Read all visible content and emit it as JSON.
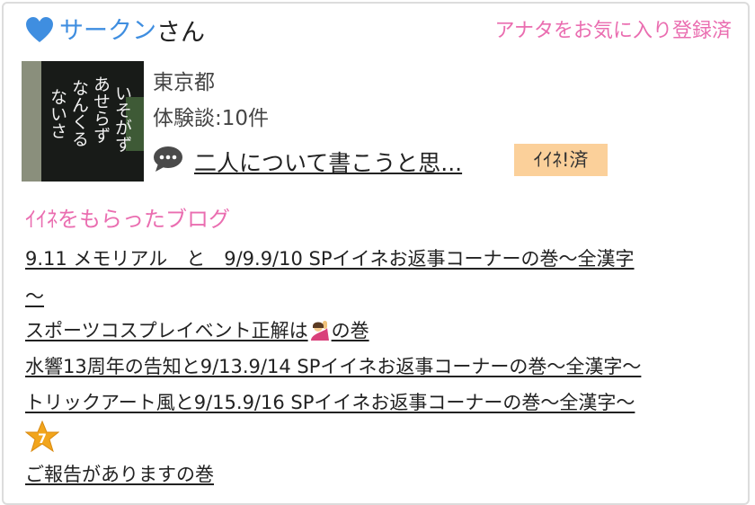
{
  "user": {
    "name": "サークン",
    "suffix": "さん",
    "favorite_status": "アナタをお気に入り登録済",
    "prefecture": "東京都",
    "taiken_label": "体験談:10件",
    "avatar_text": [
      "いそがず",
      "あせらず",
      "なんくる",
      "ないさ"
    ]
  },
  "latest_post": {
    "title": "二人について書こうと思...",
    "iine_badge": "ｲｲﾈ!済"
  },
  "blogs": {
    "heading": "ｲｲﾈをもらったブログ",
    "items": [
      {
        "line1": "9.11 メモリアル　と　9/9.9/10 SPイイネお返事コーナーの巻〜全漢字",
        "line2": "〜"
      },
      {
        "before": "スポーツコスプレイベント正解は",
        "after": "の巻",
        "emoji": "person-raising-hand"
      },
      {
        "text": "水響13周年の告知と9/13.9/14 SPイイネお返事コーナーの巻〜全漢字〜"
      },
      {
        "text": "トリックアート風と9/15.9/16 SPイイネお返事コーナーの巻〜全漢字〜"
      },
      {
        "badge_number": "7",
        "text": "ご報告がありますの巻"
      }
    ]
  },
  "colors": {
    "name_blue": "#3f8ee0",
    "pink": "#ea6db0",
    "badge_orange": "#fbd09a",
    "star_gold": "#f2a51c"
  }
}
